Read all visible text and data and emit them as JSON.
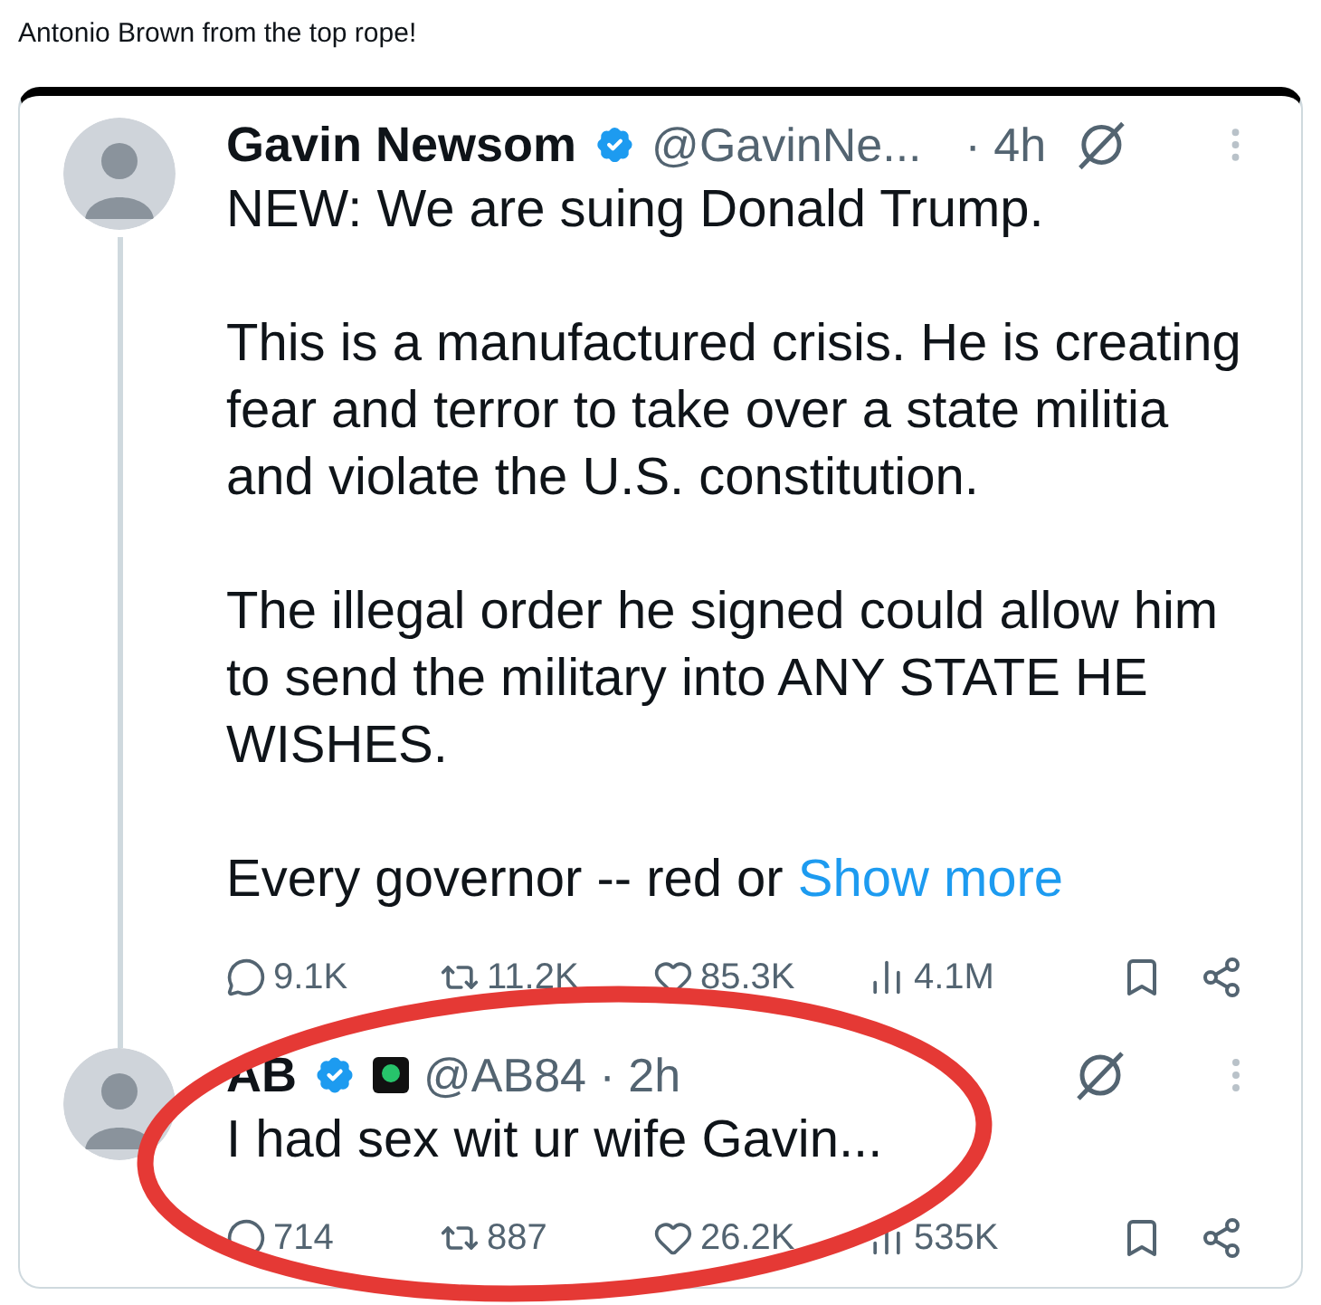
{
  "caption": "Antonio Brown from the top rope!",
  "tweets": [
    {
      "name": "Gavin Newsom",
      "verified": true,
      "affiliate": false,
      "handle": "@GavinNe...",
      "time": "· 4h",
      "paragraphs": [
        "NEW: We are suing Donald Trump.",
        "This is a manufactured crisis. He is creating fear and terror to take over a state militia and violate the U.S. constitution.",
        "The illegal order he signed could allow him to send the military into ANY STATE HE WISHES.",
        "Every governor -- red or"
      ],
      "show_more": "Show more",
      "thread_line": true,
      "stats": {
        "replies": "9.1K",
        "reposts": "11.2K",
        "likes": "85.3K",
        "views": "4.1M"
      }
    },
    {
      "name": "AB",
      "verified": true,
      "affiliate": true,
      "handle": "@AB84 · 2h",
      "paragraphs": [
        "I had sex wit ur wife Gavin..."
      ],
      "thread_line": false,
      "stats": {
        "replies": "714",
        "reposts": "887",
        "likes": "26.2K",
        "views": "535K"
      }
    }
  ],
  "annotation": {
    "kind": "ellipse",
    "color": "#e53935"
  }
}
